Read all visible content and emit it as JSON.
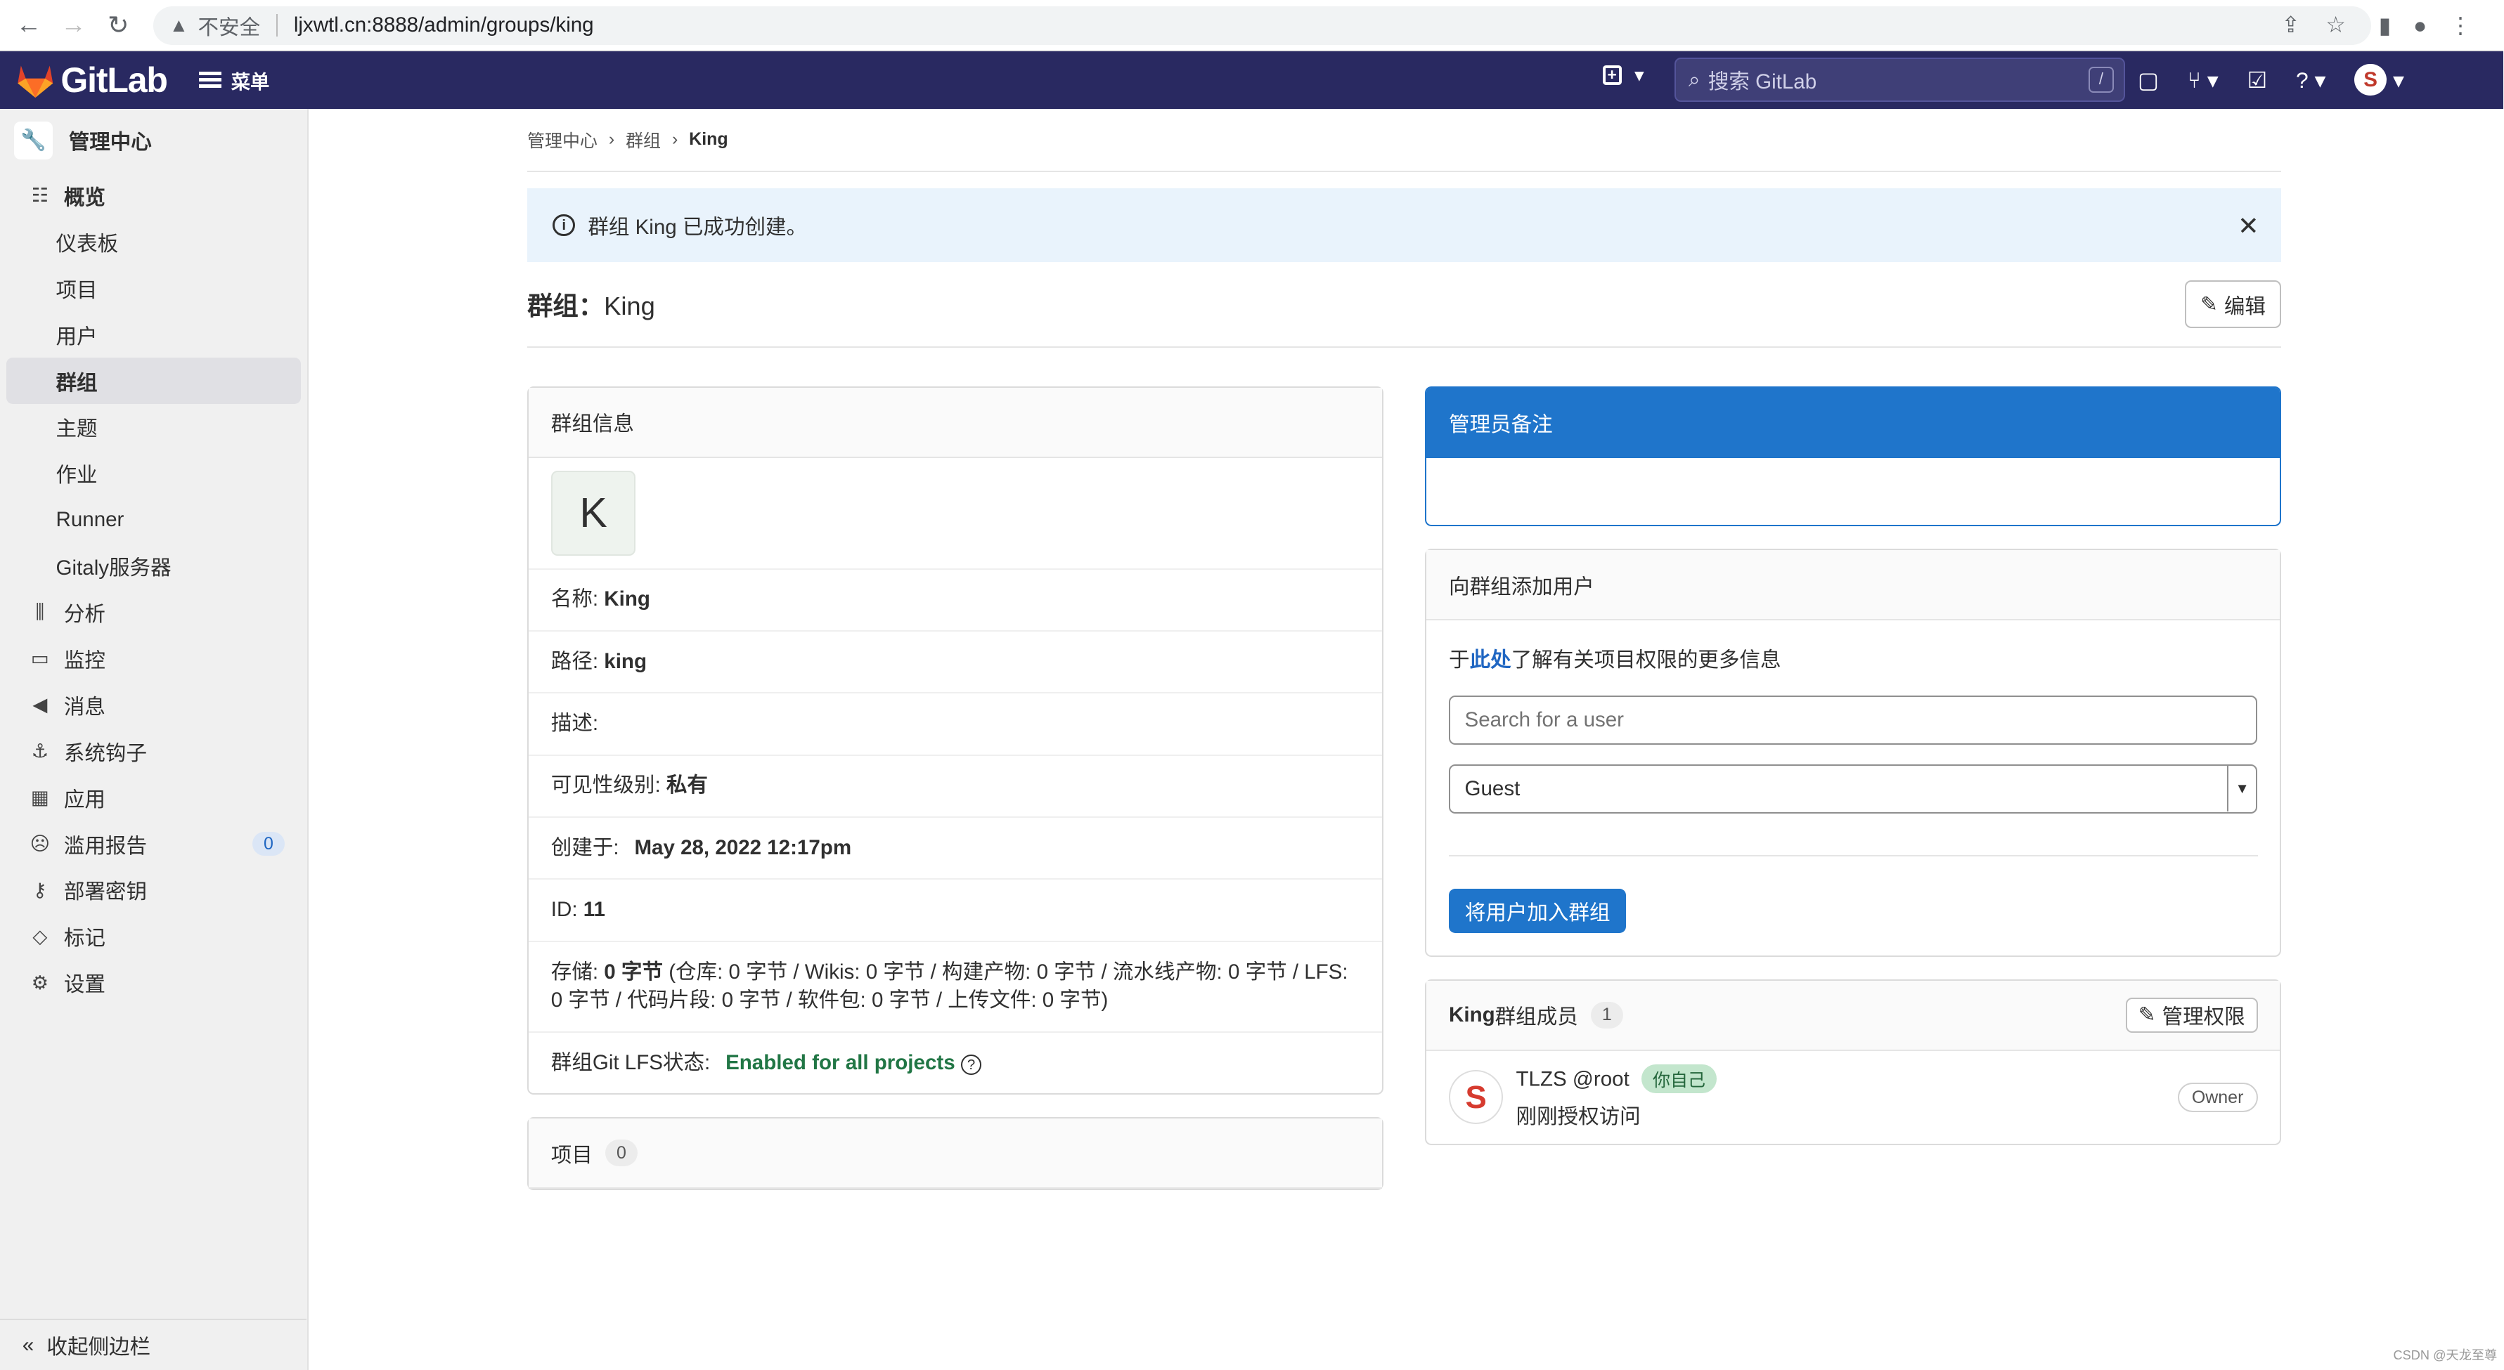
{
  "browser": {
    "insecure_label": "不安全",
    "url": "ljxwtl.cn:8888/admin/groups/king"
  },
  "header": {
    "logo_text": "GitLab",
    "menu_label": "菜单",
    "search_placeholder": "搜索 GitLab",
    "search_shortcut": "/"
  },
  "sidebar": {
    "title": "管理中心",
    "items": [
      {
        "label": "概览",
        "icon": "overview-icon"
      },
      {
        "label": "仪表板"
      },
      {
        "label": "项目"
      },
      {
        "label": "用户"
      },
      {
        "label": "群组"
      },
      {
        "label": "主题"
      },
      {
        "label": "作业"
      },
      {
        "label": "Runner"
      },
      {
        "label": "Gitaly服务器"
      },
      {
        "label": "分析",
        "icon": "analytics-icon"
      },
      {
        "label": "监控",
        "icon": "monitor-icon"
      },
      {
        "label": "消息",
        "icon": "messages-icon"
      },
      {
        "label": "系统钩子",
        "icon": "hook-icon"
      },
      {
        "label": "应用",
        "icon": "apps-icon"
      },
      {
        "label": "滥用报告",
        "icon": "abuse-icon",
        "badge": "0"
      },
      {
        "label": "部署密钥",
        "icon": "key-icon"
      },
      {
        "label": "标记",
        "icon": "label-icon"
      },
      {
        "label": "设置",
        "icon": "settings-icon"
      }
    ],
    "collapse_label": "收起侧边栏"
  },
  "breadcrumb": [
    "管理中心",
    "群组",
    "King"
  ],
  "alert": {
    "text": "群组 King 已成功创建。"
  },
  "page": {
    "title_prefix": "群组：",
    "title_name": "King",
    "edit_label": "编辑"
  },
  "group_info": {
    "heading": "群组信息",
    "avatar_letter": "K",
    "name_label": "名称: ",
    "name_value": "King",
    "path_label": "路径: ",
    "path_value": "king",
    "desc_label": "描述:",
    "visibility_label": "可见性级别: ",
    "visibility_value": "私有",
    "created_label": "创建于: ",
    "created_value": "May 28, 2022 12:17pm",
    "id_label": "ID: ",
    "id_value": "11",
    "storage_label": "存储: ",
    "storage_value": "0 字节",
    "storage_detail": " (仓库: 0 字节 / Wikis: 0 字节 / 构建产物: 0 字节 / 流水线产物: 0 字节 / LFS: 0 字节 / 代码片段: 0 字节 / 软件包: 0 字节 / 上传文件: 0 字节)",
    "lfs_label": "群组Git LFS状态: ",
    "lfs_value": "Enabled for all projects"
  },
  "projects": {
    "label": "项目",
    "count": "0"
  },
  "admin_note": {
    "heading": "管理员备注"
  },
  "add_user": {
    "heading": "向群组添加用户",
    "info_prefix": "于",
    "info_link": "此处",
    "info_suffix": "了解有关项目权限的更多信息",
    "search_placeholder": "Search for a user",
    "role_selected": "Guest",
    "submit_label": "将用户加入群组"
  },
  "members": {
    "group_name": "King",
    "heading_suffix": "群组成员",
    "count": "1",
    "manage_label": "管理权限",
    "list": [
      {
        "name": "TLZS",
        "username": "@root",
        "you_badge": "你自己",
        "sub": "刚刚授权访问",
        "role": "Owner"
      }
    ]
  },
  "watermark": "CSDN @天龙至尊",
  "colors": {
    "header_bg": "#292961",
    "primary": "#1f75cb",
    "alert_bg": "#e9f3fc",
    "success": "#217645"
  }
}
